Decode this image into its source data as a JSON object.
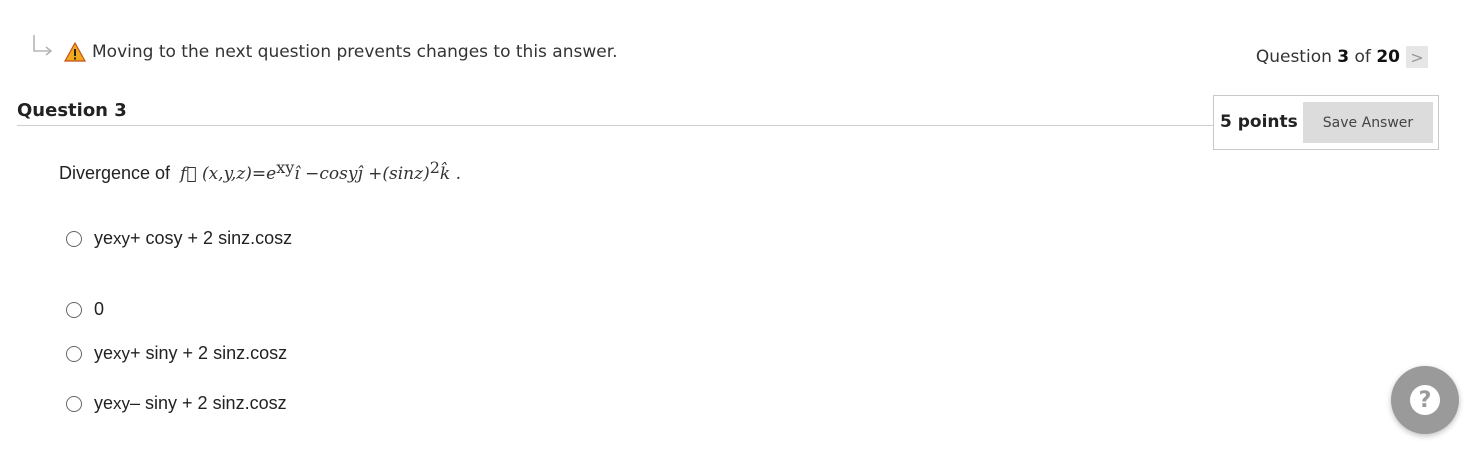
{
  "notice": {
    "text": "Moving to the next question prevents changes to this answer.",
    "icon": "warning-icon",
    "warning_color": "#e8a317"
  },
  "nav": {
    "prefix": "Question",
    "current": "3",
    "of": "of",
    "total": "20",
    "next_symbol": ">"
  },
  "question": {
    "title": "Question 3",
    "points": "5 points",
    "save_label": "Save Answer",
    "prompt_label": "Divergence of",
    "formula_main": "f⃗ (x,y,z)=e",
    "formula_exp": "xy",
    "formula_mid": "î −cosyĵ +(sinz)",
    "formula_exp2": "2",
    "formula_end": "k̂ ."
  },
  "options": [
    {
      "base": "ye",
      "exp": "xy",
      "rest": "+ cosy + 2 sinz.cosz"
    },
    {
      "base": "0",
      "exp": "",
      "rest": ""
    },
    {
      "base": "ye",
      "exp": "xy",
      "rest": "+ siny + 2 sinz.cosz"
    },
    {
      "base": "ye",
      "exp": "xy",
      "rest": "– siny + 2 sinz.cosz"
    }
  ],
  "help": {
    "symbol": "?"
  }
}
